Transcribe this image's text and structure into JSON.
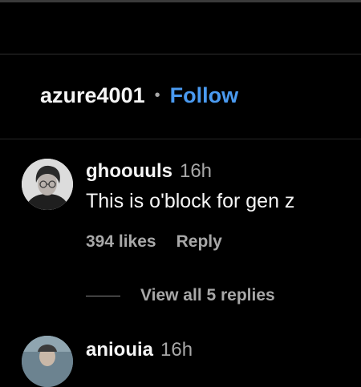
{
  "post_header": {
    "username": "azure4001",
    "separator": "•",
    "follow_label": "Follow"
  },
  "comments": [
    {
      "username": "ghoouuls",
      "time": "16h",
      "text": "This is o'block for gen z",
      "likes": "394 likes",
      "reply_label": "Reply",
      "view_replies": "View all 5 replies"
    },
    {
      "username": "aniouia",
      "time": "16h"
    }
  ],
  "colors": {
    "background": "#000000",
    "primary_text": "#f5f5f5",
    "secondary_text": "#a8a8a8",
    "follow_accent": "#4a9af0"
  }
}
